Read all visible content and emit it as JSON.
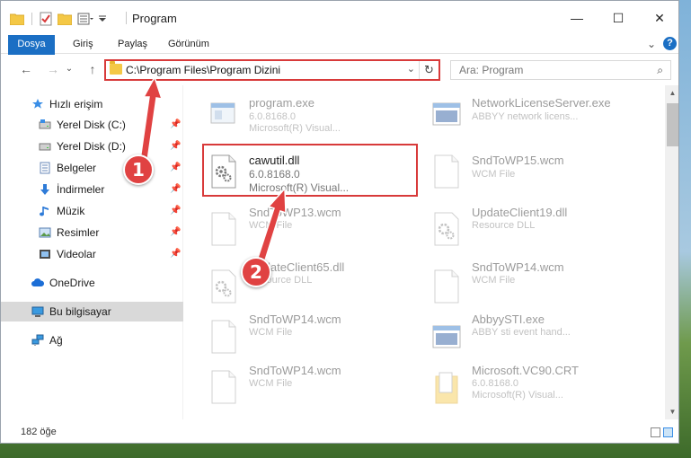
{
  "window": {
    "title": "Program",
    "minimize_glyph": "—",
    "maximize_glyph": "☐",
    "close_glyph": "✕"
  },
  "ribbon": {
    "tabs": [
      "Dosya",
      "Giriş",
      "Paylaş",
      "Görünüm"
    ],
    "accent": "#1b6fc4",
    "expand_glyph": "⌄",
    "help_glyph": "?"
  },
  "navigation": {
    "back_glyph": "←",
    "forward_glyph": "→",
    "recent_glyph": "⌄",
    "up_glyph": "↑",
    "address": "C:\\Program Files\\Program Dizini",
    "address_dropdown_glyph": "⌄",
    "refresh_glyph": "↻",
    "search_placeholder": "Ara: Program",
    "search_glyph": "⌕"
  },
  "sidebar": {
    "items": [
      {
        "label": "Hızlı erişim",
        "icon": "star-icon",
        "pinned": false
      },
      {
        "label": "Yerel Disk (C:)",
        "icon": "drive-icon",
        "pinned": true
      },
      {
        "label": "Yerel Disk (D:)",
        "icon": "drive-icon",
        "pinned": true
      },
      {
        "label": "Belgeler",
        "icon": "documents-icon",
        "pinned": true
      },
      {
        "label": "İndirmeler",
        "icon": "download-icon",
        "pinned": true
      },
      {
        "label": "Müzik",
        "icon": "music-icon",
        "pinned": true
      },
      {
        "label": "Resimler",
        "icon": "pictures-icon",
        "pinned": true
      },
      {
        "label": "Videolar",
        "icon": "videos-icon",
        "pinned": true
      },
      {
        "label": "OneDrive",
        "icon": "cloud-icon",
        "pinned": false
      },
      {
        "label": "Bu bilgisayar",
        "icon": "computer-icon",
        "pinned": false
      },
      {
        "label": "Ağ",
        "icon": "network-icon",
        "pinned": false
      }
    ],
    "pin_glyph": "📌"
  },
  "files": [
    {
      "name": "program.exe",
      "line1": "6.0.8168.0",
      "line2": "Microsoft(R) Visual...",
      "icon": "exe-icon",
      "faded": true
    },
    {
      "name": "NetworkLicenseServer.exe",
      "line1": "ABBYY network licens...",
      "line2": "",
      "icon": "window-icon",
      "faded": true
    },
    {
      "name": "cawutil.dll",
      "line1": "6.0.8168.0",
      "line2": "Microsoft(R) Visual...",
      "icon": "dll-gear-icon",
      "faded": false
    },
    {
      "name": "SndToWP15.wcm",
      "line1": "WCM File",
      "line2": "",
      "icon": "blank-file-icon",
      "faded": true
    },
    {
      "name": "SndToWP13.wcm",
      "line1": "WCM File",
      "line2": "",
      "icon": "blank-file-icon",
      "faded": true
    },
    {
      "name": "UpdateClient19.dll",
      "line1": "Resource DLL",
      "line2": "",
      "icon": "dll-gear-icon",
      "faded": true
    },
    {
      "name": "UpdateClient65.dll",
      "line1": "Resource DLL",
      "line2": "",
      "icon": "dll-gear-icon",
      "faded": true
    },
    {
      "name": "SndToWP14.wcm",
      "line1": "WCM File",
      "line2": "",
      "icon": "blank-file-icon",
      "faded": true
    },
    {
      "name": "SndToWP14.wcm",
      "line1": "WCM File",
      "line2": "",
      "icon": "blank-file-icon",
      "faded": true
    },
    {
      "name": "AbbyySTI.exe",
      "line1": "ABBY sti event hand...",
      "line2": "",
      "icon": "window-icon",
      "faded": true
    },
    {
      "name": "SndToWP14.wcm",
      "line1": "WCM File",
      "line2": "",
      "icon": "blank-file-icon",
      "faded": true
    },
    {
      "name": "Microsoft.VC90.CRT",
      "line1": "6.0.8168.0",
      "line2": "Microsoft(R) Visual...",
      "icon": "folder-doc-icon",
      "faded": true
    }
  ],
  "status": {
    "item_count": "182 öğe"
  },
  "callouts": {
    "step1": "1",
    "step2": "2",
    "color": "#e04242"
  }
}
